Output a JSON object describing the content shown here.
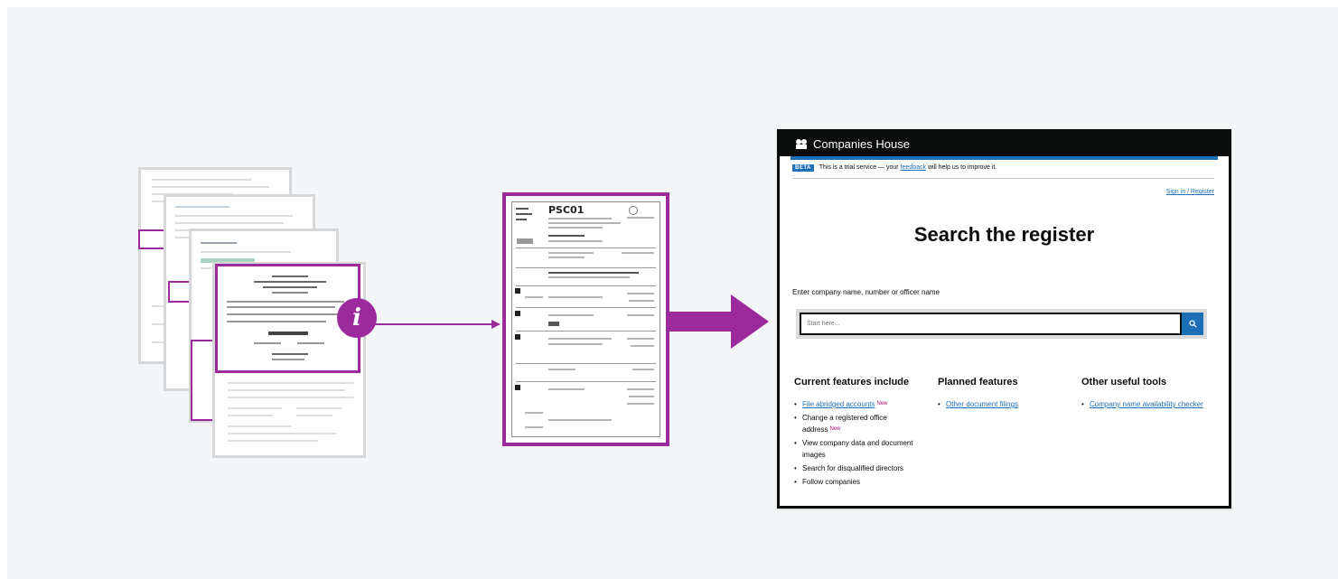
{
  "colors": {
    "accent_purple": "#9b2a9c",
    "gov_black": "#0b0c0c",
    "link_blue": "#1d70b8",
    "background": "#f3f5f7"
  },
  "info_badge": {
    "glyph": "i",
    "icon": "info-icon"
  },
  "form_card": {
    "form_code": "PSC01"
  },
  "website": {
    "header": {
      "brand": "Companies House",
      "crest_icon": "royal-crest-icon"
    },
    "beta_banner": {
      "tag": "BETA",
      "text_before": "This is a trial service — your",
      "link": "feedback",
      "text_after": "will help us to improve it."
    },
    "signin_link": "Sign in / Register",
    "page_title": "Search the register",
    "search": {
      "label": "Enter company name, number or officer name",
      "placeholder": "Start here...",
      "button_icon": "search-icon"
    },
    "columns": [
      {
        "heading": "Current features include",
        "items": [
          {
            "text": "File abridged accounts",
            "link": true,
            "badge": "New"
          },
          {
            "text": "Change a registered office address",
            "link": false,
            "badge": "New"
          },
          {
            "text": "View company data and document images",
            "link": false,
            "badge": ""
          },
          {
            "text": "Search for disqualified directors",
            "link": false,
            "badge": ""
          },
          {
            "text": "Follow companies",
            "link": false,
            "badge": ""
          }
        ]
      },
      {
        "heading": "Planned features",
        "items": [
          {
            "text": "Other document filings",
            "link": true,
            "badge": ""
          }
        ]
      },
      {
        "heading": "Other useful tools",
        "items": [
          {
            "text": "Company name availability checker",
            "link": true,
            "badge": ""
          }
        ]
      }
    ]
  }
}
